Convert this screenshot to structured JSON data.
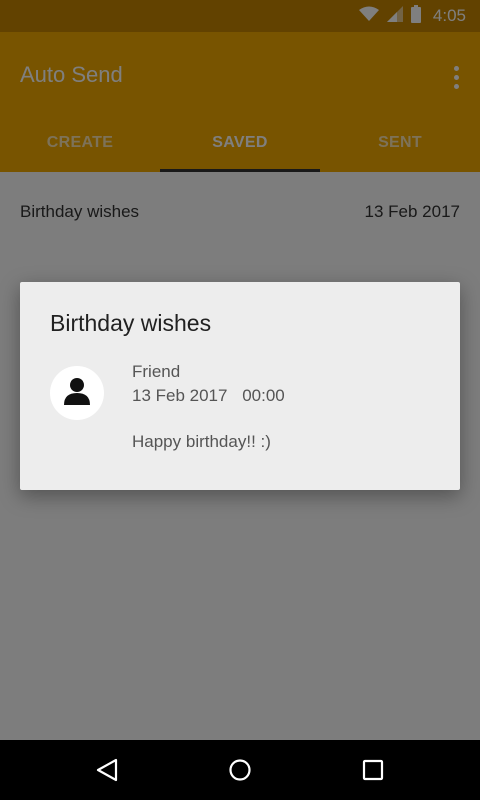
{
  "status_bar": {
    "time": "4:05"
  },
  "app_bar": {
    "title": "Auto Send"
  },
  "tabs": [
    {
      "label": "CREATE"
    },
    {
      "label": "SAVED"
    },
    {
      "label": "SENT"
    }
  ],
  "saved_list": [
    {
      "title": "Birthday wishes",
      "date": "13 Feb 2017"
    }
  ],
  "dialog": {
    "title": "Birthday wishes",
    "recipient": "Friend",
    "date": "13 Feb 2017",
    "time": "00:00",
    "message": "Happy birthday!! :)"
  },
  "icons": {
    "wifi": "wifi-icon",
    "signal": "cell-signal-icon",
    "battery": "battery-icon",
    "overflow": "more-vert-icon",
    "avatar": "person-icon",
    "back": "nav-back-icon",
    "home": "nav-home-icon",
    "recents": "nav-recents-icon"
  },
  "colors": {
    "primary": "#f0a800",
    "primary_dark": "#c58400",
    "tab_indicator": "#333333"
  }
}
